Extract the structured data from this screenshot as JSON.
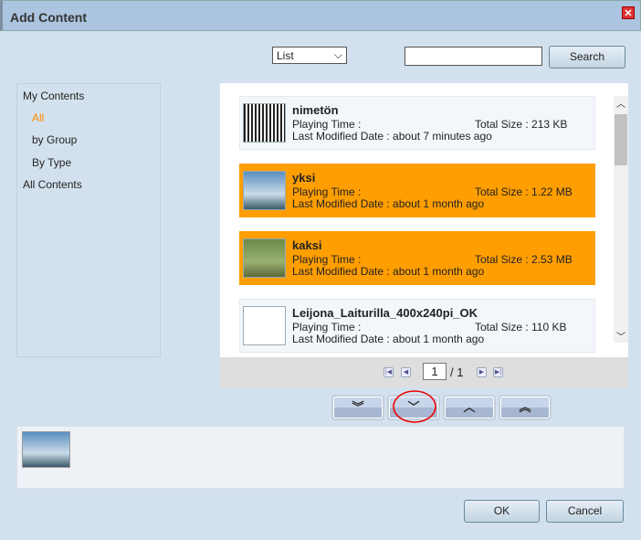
{
  "dialog": {
    "title": "Add Content"
  },
  "toolbar": {
    "view_select": "List",
    "search_value": "",
    "search_label": "Search"
  },
  "sidebar": {
    "items": [
      {
        "label": "My Contents"
      },
      {
        "label": "All"
      },
      {
        "label": "by Group"
      },
      {
        "label": "By Type"
      },
      {
        "label": "All Contents"
      }
    ]
  },
  "list": {
    "playing_label": "Playing Time :",
    "items": [
      {
        "name": "nimetön",
        "size": "Total Size : 213 KB",
        "modified": "Last Modified Date : about 7 minutes ago",
        "selected": false
      },
      {
        "name": "yksi",
        "size": "Total Size : 1.22 MB",
        "modified": "Last Modified Date : about 1 month ago",
        "selected": true
      },
      {
        "name": "kaksi",
        "size": "Total Size : 2.53 MB",
        "modified": "Last Modified Date : about 1 month ago",
        "selected": true
      },
      {
        "name": "Leijona_Laiturilla_400x240pi_OK",
        "size": "Total Size : 110 KB",
        "modified": "Last Modified Date : about 1 month ago",
        "selected": false
      }
    ]
  },
  "pager": {
    "page": "1",
    "total": "/ 1"
  },
  "footer": {
    "ok": "OK",
    "cancel": "Cancel"
  },
  "colors": {
    "selected": "#ff9e00",
    "accent": "#ff8c00"
  }
}
